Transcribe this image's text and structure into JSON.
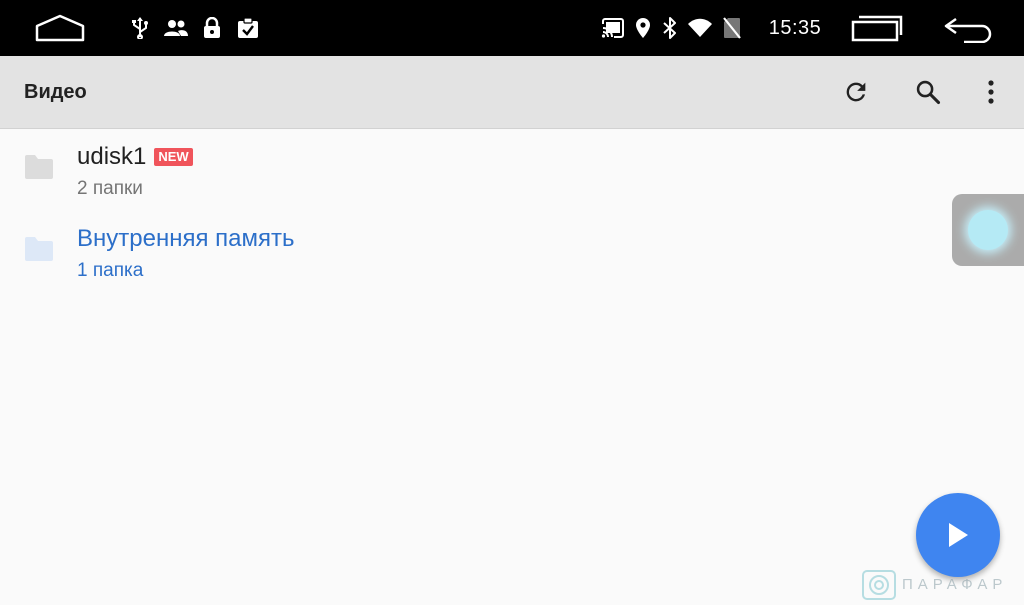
{
  "status_bar": {
    "time": "15:35",
    "icons": [
      "home-outline-icon",
      "usb-icon",
      "people-icon",
      "lock-icon",
      "clipboard-check-icon",
      "cast-icon",
      "location-icon",
      "bluetooth-icon",
      "wifi-icon",
      "no-sim-icon",
      "recents-icon",
      "back-icon"
    ]
  },
  "toolbar": {
    "title": "Видео",
    "actions": [
      "refresh-icon",
      "search-icon",
      "more-vert-icon"
    ]
  },
  "folders": [
    {
      "name": "udisk1",
      "badge": "NEW",
      "count": "2 папки",
      "selected": false
    },
    {
      "name": "Внутренняя память",
      "count": "1 папка",
      "selected": true
    }
  ],
  "fab": {
    "icon": "play-icon",
    "color": "#3f85f0"
  },
  "watermark": {
    "text": "ПАРАФАР"
  },
  "colors": {
    "accent": "#2c6fc9",
    "badge": "#f0545b",
    "toolbar": "#e3e3e3"
  }
}
